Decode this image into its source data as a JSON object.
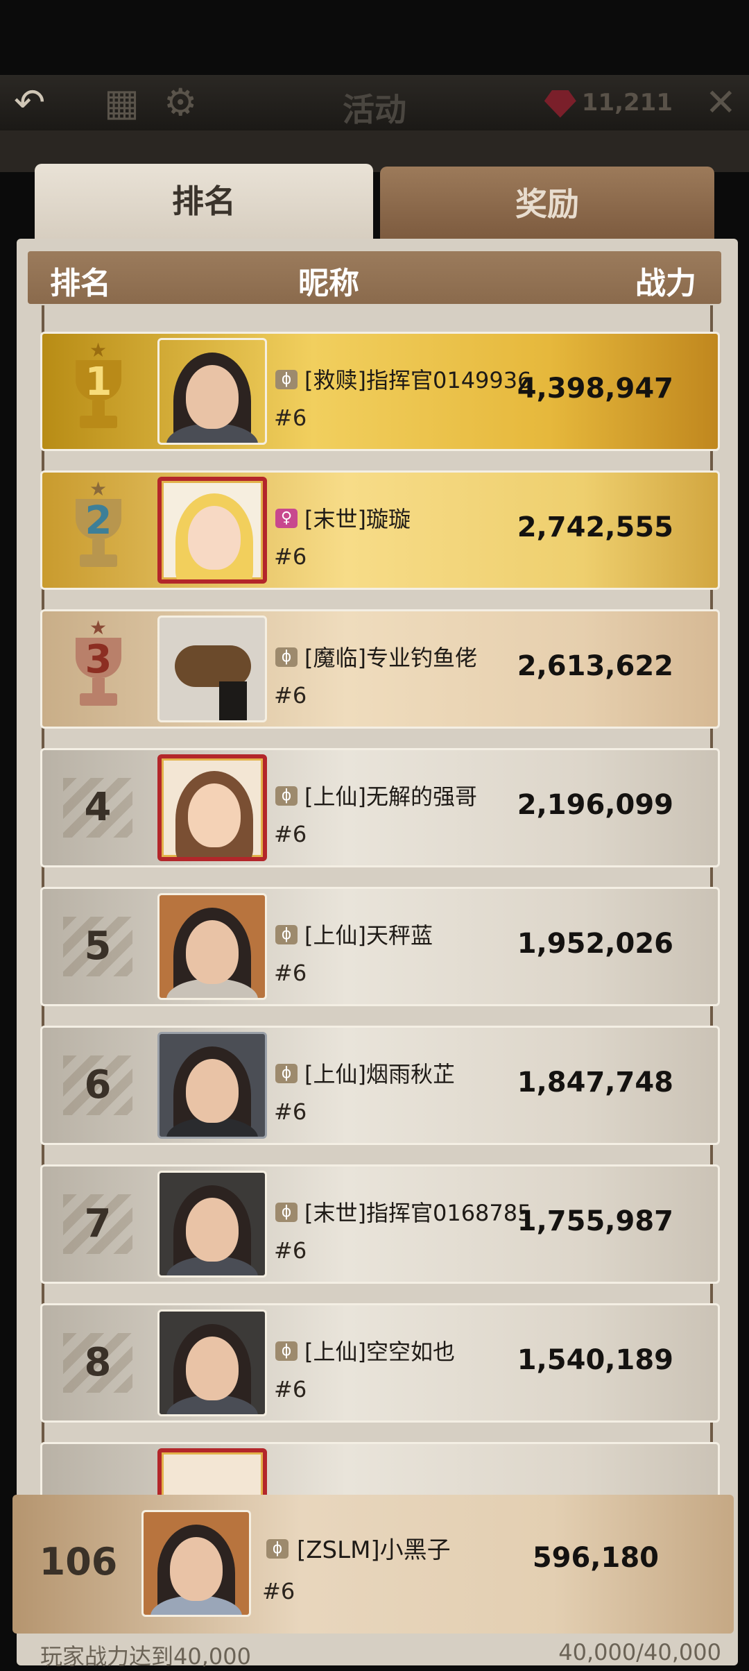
{
  "topbar": {
    "title": "活动",
    "gem_count": "11,211",
    "icons": [
      "back-arrow-icon",
      "settings-gear-icon",
      "gem-icon",
      "close-icon"
    ]
  },
  "tabs": {
    "ranking": "排名",
    "rewards": "奖励",
    "active": "ranking"
  },
  "table_header": {
    "rank": "排名",
    "nickname": "昵称",
    "power": "战力"
  },
  "rows": [
    {
      "rank": "1",
      "name": "[救赎]指挥官0149936",
      "server": "#6",
      "power": "4,398,947",
      "tier": "gold",
      "tag": "ϕ"
    },
    {
      "rank": "2",
      "name": "[末世]璇璇",
      "server": "#6",
      "power": "2,742,555",
      "tier": "silver-gold",
      "tag": "♀"
    },
    {
      "rank": "3",
      "name": "[魔临]专业钓鱼佬",
      "server": "#6",
      "power": "2,613,622",
      "tier": "bronze",
      "tag": "ϕ"
    },
    {
      "rank": "4",
      "name": "[上仙]无解的强哥",
      "server": "#6",
      "power": "2,196,099",
      "tier": "plain",
      "tag": "ϕ"
    },
    {
      "rank": "5",
      "name": "[上仙]天秤蓝",
      "server": "#6",
      "power": "1,952,026",
      "tier": "plain",
      "tag": "ϕ"
    },
    {
      "rank": "6",
      "name": "[上仙]烟雨秋芷",
      "server": "#6",
      "power": "1,847,748",
      "tier": "plain",
      "tag": "ϕ"
    },
    {
      "rank": "7",
      "name": "[末世]指挥官0168785",
      "server": "#6",
      "power": "1,755,987",
      "tier": "plain",
      "tag": "ϕ"
    },
    {
      "rank": "8",
      "name": "[上仙]空空如也",
      "server": "#6",
      "power": "1,540,189",
      "tier": "plain",
      "tag": "ϕ"
    }
  ],
  "my_row": {
    "rank": "106",
    "name": "[ZSLM]小黑子",
    "server": "#6",
    "power": "596,180",
    "tag": "ϕ"
  },
  "footer": {
    "left": "玩家战力达到40,000",
    "right": "40,000/40,000"
  },
  "colors": {
    "gold": "#e6b83c",
    "panel": "#d6cfc3",
    "header": "#8a6a4c",
    "tab_inactive": "#8a684a"
  }
}
